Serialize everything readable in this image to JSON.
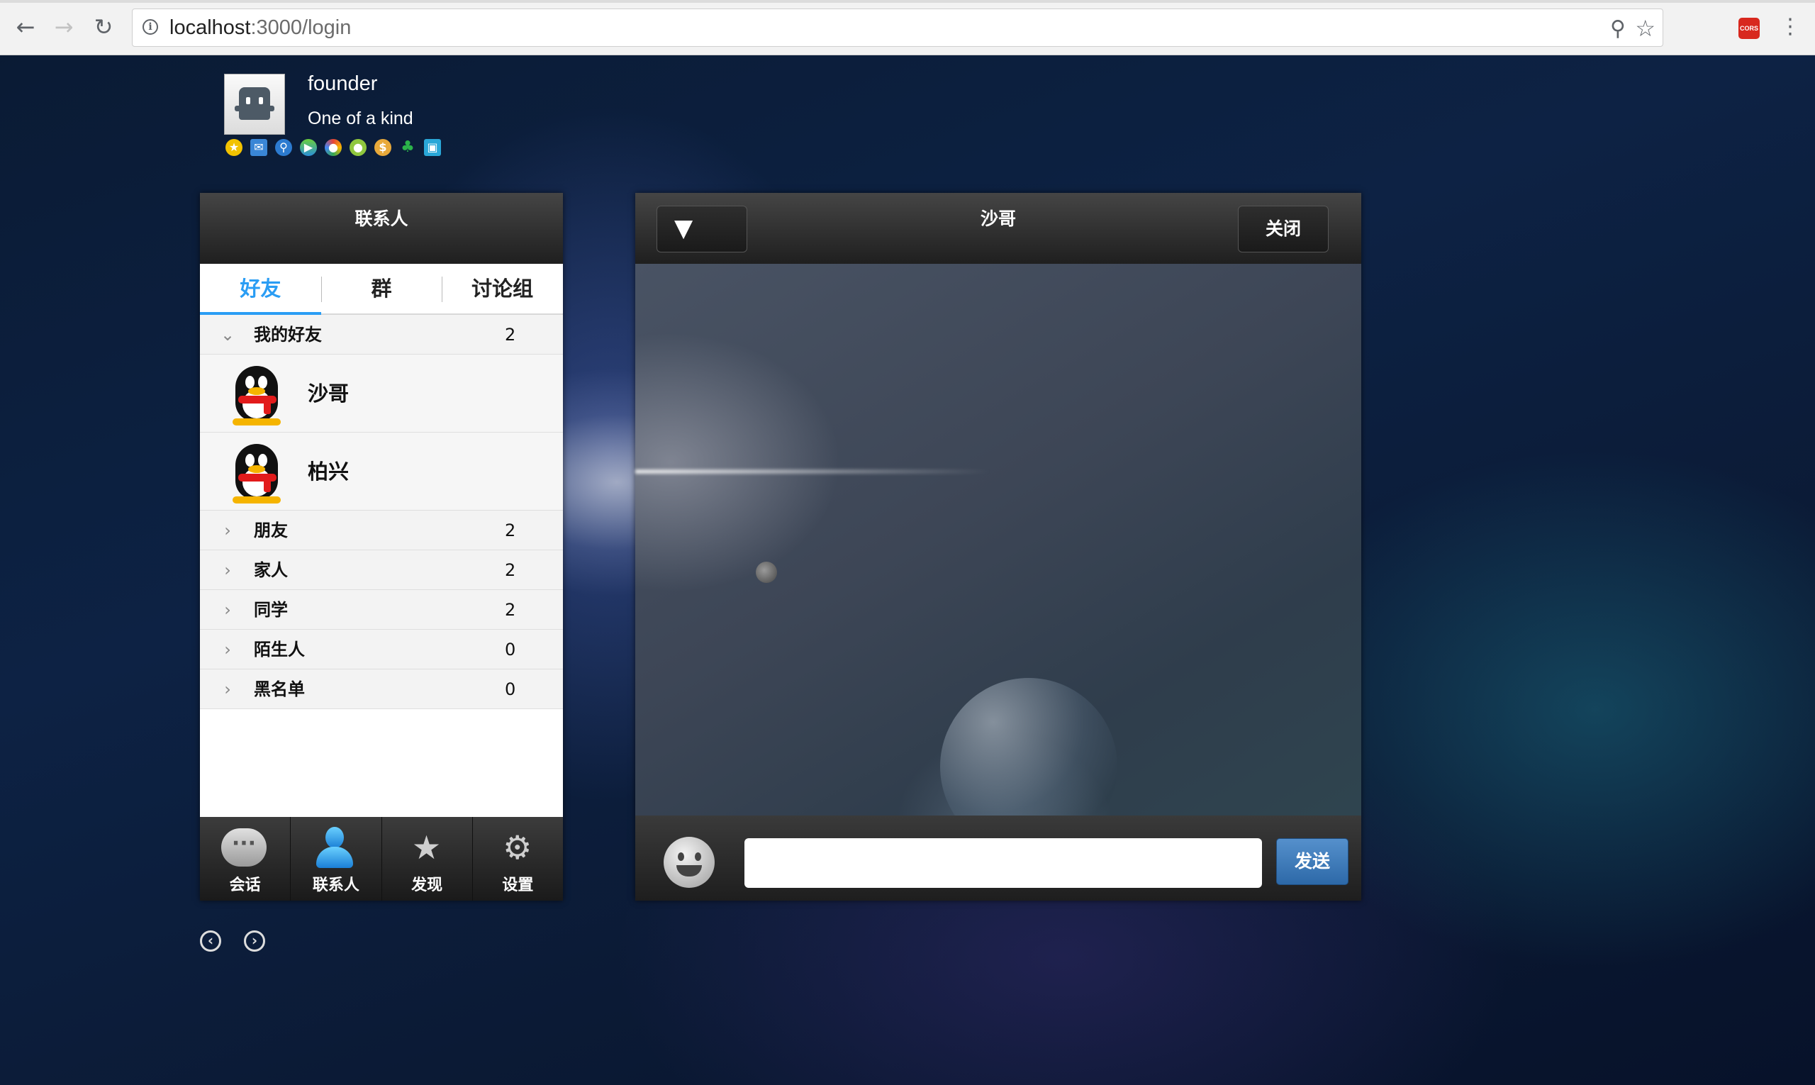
{
  "browser": {
    "url_host": "localhost",
    "url_path": ":3000/login",
    "extension_label": "CORS"
  },
  "profile": {
    "name": "founder",
    "signature": "One of a kind",
    "status_icons": [
      "star-icon",
      "mail-icon",
      "search-icon",
      "video-play-icon",
      "browser-icon",
      "fruit-icon",
      "money-bag-icon",
      "clover-icon",
      "photo-icon"
    ]
  },
  "contacts": {
    "title": "联系人",
    "tabs": [
      {
        "label": "好友",
        "active": true
      },
      {
        "label": "群",
        "active": false
      },
      {
        "label": "讨论组",
        "active": false
      }
    ],
    "expanded_group": {
      "name": "我的好友",
      "count": "2"
    },
    "friends": [
      {
        "name": "沙哥"
      },
      {
        "name": "柏兴"
      }
    ],
    "groups": [
      {
        "name": "朋友",
        "count": "2"
      },
      {
        "name": "家人",
        "count": "2"
      },
      {
        "name": "同学",
        "count": "2"
      },
      {
        "name": "陌生人",
        "count": "0"
      },
      {
        "name": "黑名单",
        "count": "0"
      }
    ],
    "tabbar": [
      {
        "label": "会话",
        "icon": "chat-bubble-icon"
      },
      {
        "label": "联系人",
        "icon": "contacts-person-icon"
      },
      {
        "label": "发现",
        "icon": "discover-star-icon"
      },
      {
        "label": "设置",
        "icon": "settings-gear-icon"
      }
    ]
  },
  "chat": {
    "title": "沙哥",
    "close_label": "关闭",
    "input_value": "",
    "send_label": "发送"
  },
  "colors": {
    "accent": "#2a9df4",
    "send_button": "#3d7bbd",
    "header_dark": "#2a2a2a"
  }
}
